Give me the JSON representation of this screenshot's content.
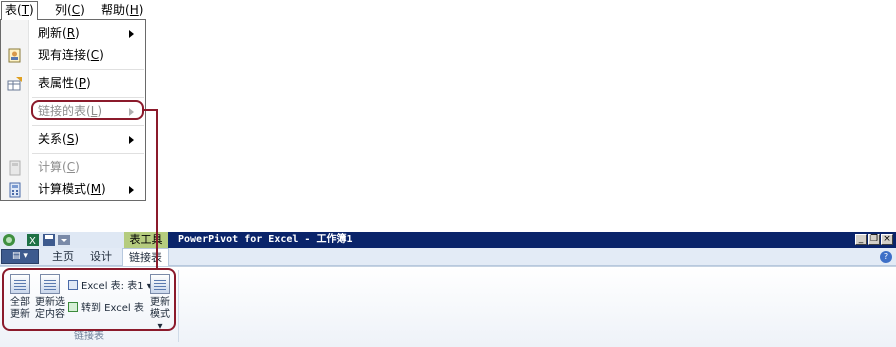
{
  "menubar": {
    "items": [
      {
        "label": "表(",
        "key": "T",
        "tail": ")"
      },
      {
        "label": "列(",
        "key": "C",
        "tail": ")"
      },
      {
        "label": "帮助(",
        "key": "H",
        "tail": ")"
      }
    ]
  },
  "dropdown": {
    "items": [
      {
        "label": "刷新(",
        "key": "R",
        "tail": ")",
        "submenu": true,
        "disabled": false,
        "icon": ""
      },
      {
        "label": "现有连接(",
        "key": "C",
        "tail": ")",
        "submenu": false,
        "disabled": false,
        "icon": "connection-icon"
      },
      {
        "label": "表属性(",
        "key": "P",
        "tail": ")",
        "submenu": false,
        "disabled": false,
        "icon": "table-properties-icon"
      },
      {
        "label": "链接的表(",
        "key": "L",
        "tail": ")",
        "submenu": true,
        "disabled": true,
        "icon": ""
      },
      {
        "label": "关系(",
        "key": "S",
        "tail": ")",
        "submenu": true,
        "disabled": false,
        "icon": ""
      },
      {
        "label": "计算(",
        "key": "C",
        "tail": ")",
        "submenu": false,
        "disabled": true,
        "icon": "calculate-icon"
      },
      {
        "label": "计算模式(",
        "key": "M",
        "tail": ")",
        "submenu": true,
        "disabled": false,
        "icon": "calculation-mode-icon"
      }
    ]
  },
  "window": {
    "context_group": "表工具",
    "title": "PowerPivot for Excel - 工作簿1",
    "minimize": "_",
    "restore": "❐",
    "close": "×"
  },
  "tabs": {
    "file_label": "▤ ▾",
    "items": [
      "主页",
      "设计",
      "链接表"
    ],
    "active": "链接表",
    "help": "?"
  },
  "ribbon": {
    "update_all": {
      "line1": "全部",
      "line2": "更新"
    },
    "update_selected": {
      "line1": "更新选",
      "line2": "定内容"
    },
    "excel_table": "Excel 表: 表1 ▾",
    "goto_excel": "转到 Excel 表",
    "update_mode": {
      "line1": "更新",
      "line2": "模式 ▾"
    },
    "group_label": "链接表"
  },
  "colors": {
    "callout": "#8b1a2b",
    "title_bar": "#0a246a",
    "context_tab": "#b5cc7e"
  }
}
